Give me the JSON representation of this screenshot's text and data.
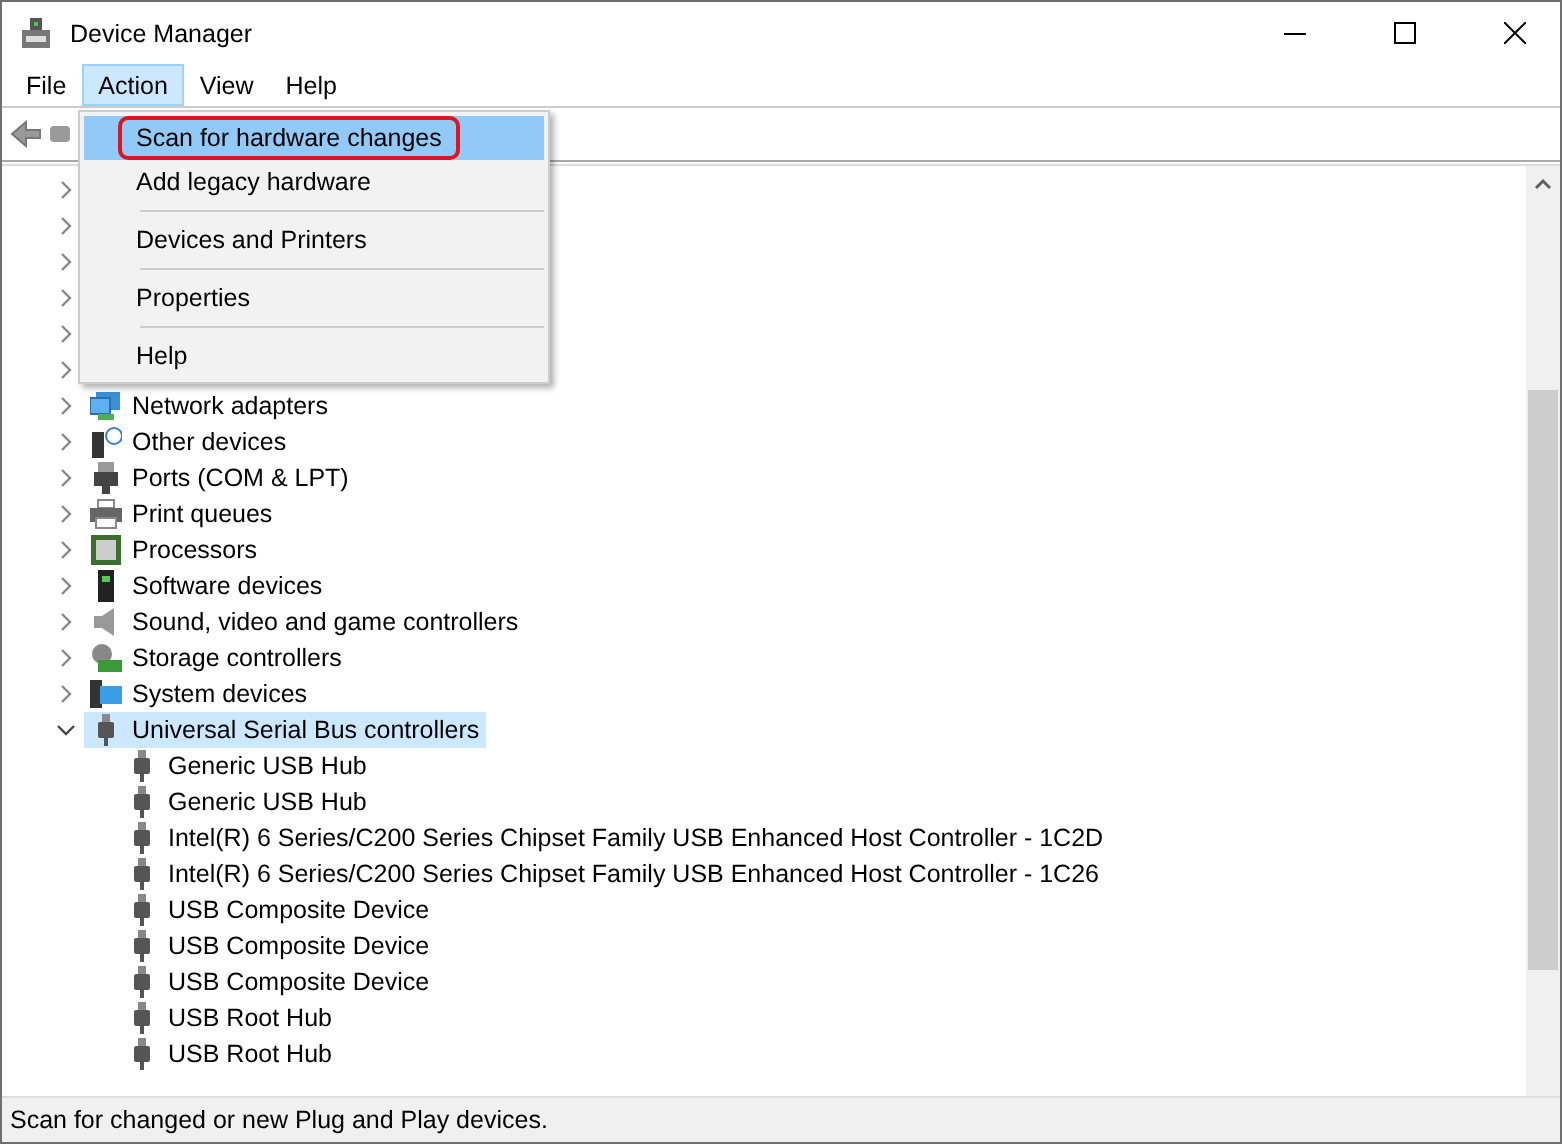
{
  "window": {
    "title": "Device Manager"
  },
  "menu_bar": [
    {
      "label": "File",
      "selected": false
    },
    {
      "label": "Action",
      "selected": true
    },
    {
      "label": "View",
      "selected": false
    },
    {
      "label": "Help",
      "selected": false
    }
  ],
  "action_menu": [
    {
      "label": "Scan for hardware changes",
      "selected": true,
      "annotated": true,
      "separator_before": false
    },
    {
      "label": "Add legacy hardware",
      "selected": false,
      "annotated": false,
      "separator_before": false
    },
    {
      "label": "Devices and Printers",
      "selected": false,
      "annotated": false,
      "separator_before": true
    },
    {
      "label": "Properties",
      "selected": false,
      "annotated": false,
      "separator_before": true
    },
    {
      "label": "Help",
      "selected": false,
      "annotated": false,
      "separator_before": true
    }
  ],
  "tree": [
    {
      "expanded": false
    },
    {
      "expanded": false
    },
    {
      "expanded": false
    },
    {
      "expanded": false
    },
    {
      "expanded": false
    },
    {
      "expanded": false
    },
    {
      "label": "Network adapters",
      "kind": "network",
      "expanded": false,
      "selected": false
    },
    {
      "label": "Other devices",
      "kind": "other",
      "expanded": false,
      "selected": false
    },
    {
      "label": "Ports (COM & LPT)",
      "kind": "port",
      "expanded": false,
      "selected": false
    },
    {
      "label": "Print queues",
      "kind": "printer",
      "expanded": false,
      "selected": false
    },
    {
      "label": "Processors",
      "kind": "chip",
      "expanded": false,
      "selected": false
    },
    {
      "label": "Software devices",
      "kind": "software",
      "expanded": false,
      "selected": false
    },
    {
      "label": "Sound, video and game controllers",
      "kind": "sound",
      "expanded": false,
      "selected": false
    },
    {
      "label": "Storage controllers",
      "kind": "storage",
      "expanded": false,
      "selected": false
    },
    {
      "label": "System devices",
      "kind": "system",
      "expanded": false,
      "selected": false
    },
    {
      "label": "Universal Serial Bus controllers",
      "kind": "usb",
      "expanded": true,
      "selected": true,
      "children": [
        {
          "label": "Generic USB Hub"
        },
        {
          "label": "Generic USB Hub"
        },
        {
          "label": "Intel(R) 6 Series/C200 Series Chipset Family USB Enhanced Host Controller - 1C2D"
        },
        {
          "label": "Intel(R) 6 Series/C200 Series Chipset Family USB Enhanced Host Controller - 1C26"
        },
        {
          "label": "USB Composite Device"
        },
        {
          "label": "USB Composite Device"
        },
        {
          "label": "USB Composite Device"
        },
        {
          "label": "USB Root Hub"
        },
        {
          "label": "USB Root Hub"
        }
      ]
    }
  ],
  "status_bar": "Scan for changed or new Plug and Play devices."
}
